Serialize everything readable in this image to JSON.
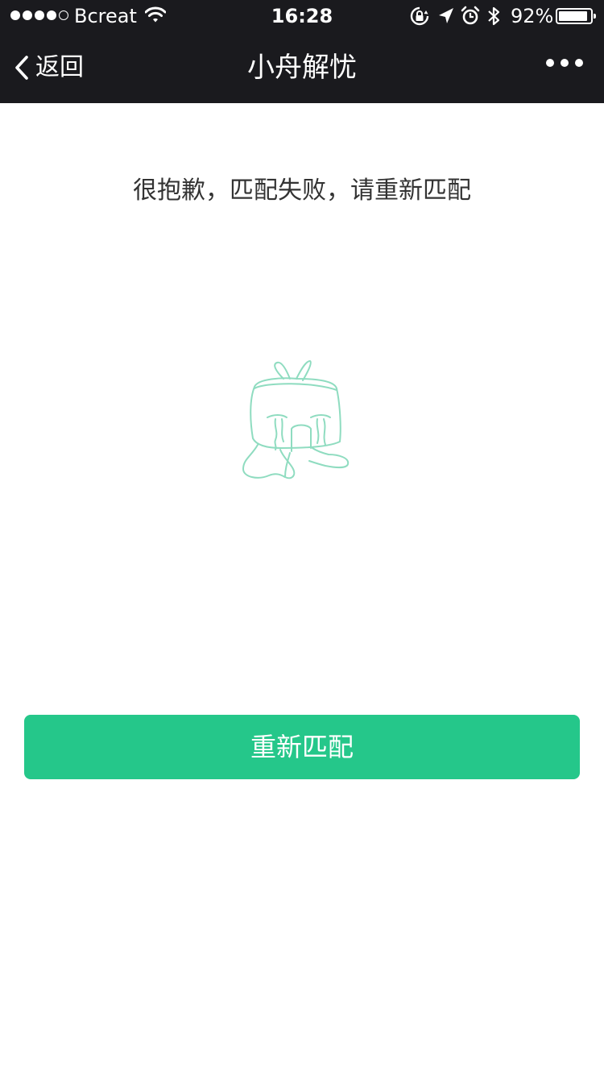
{
  "status_bar": {
    "carrier": "Bcreat",
    "time": "16:28",
    "battery_percent": "92%",
    "battery_level": 0.92,
    "signal_bars_filled": 4,
    "signal_bars_total": 5,
    "icons": [
      "wifi-icon",
      "orientation-lock-icon",
      "location-arrow-icon",
      "alarm-icon",
      "bluetooth-icon",
      "battery-icon"
    ]
  },
  "navbar": {
    "back_label": "返回",
    "title": "小舟解忧",
    "more_icon": "more-dots-icon"
  },
  "main": {
    "message": "很抱歉，匹配失败，请重新匹配",
    "illustration": "crying-character-icon",
    "retry_button": "重新匹配"
  },
  "colors": {
    "header_bg": "#1a1a1e",
    "accent": "#25c78a",
    "illustration_stroke": "#8fdcc0",
    "message_text": "#333333"
  }
}
